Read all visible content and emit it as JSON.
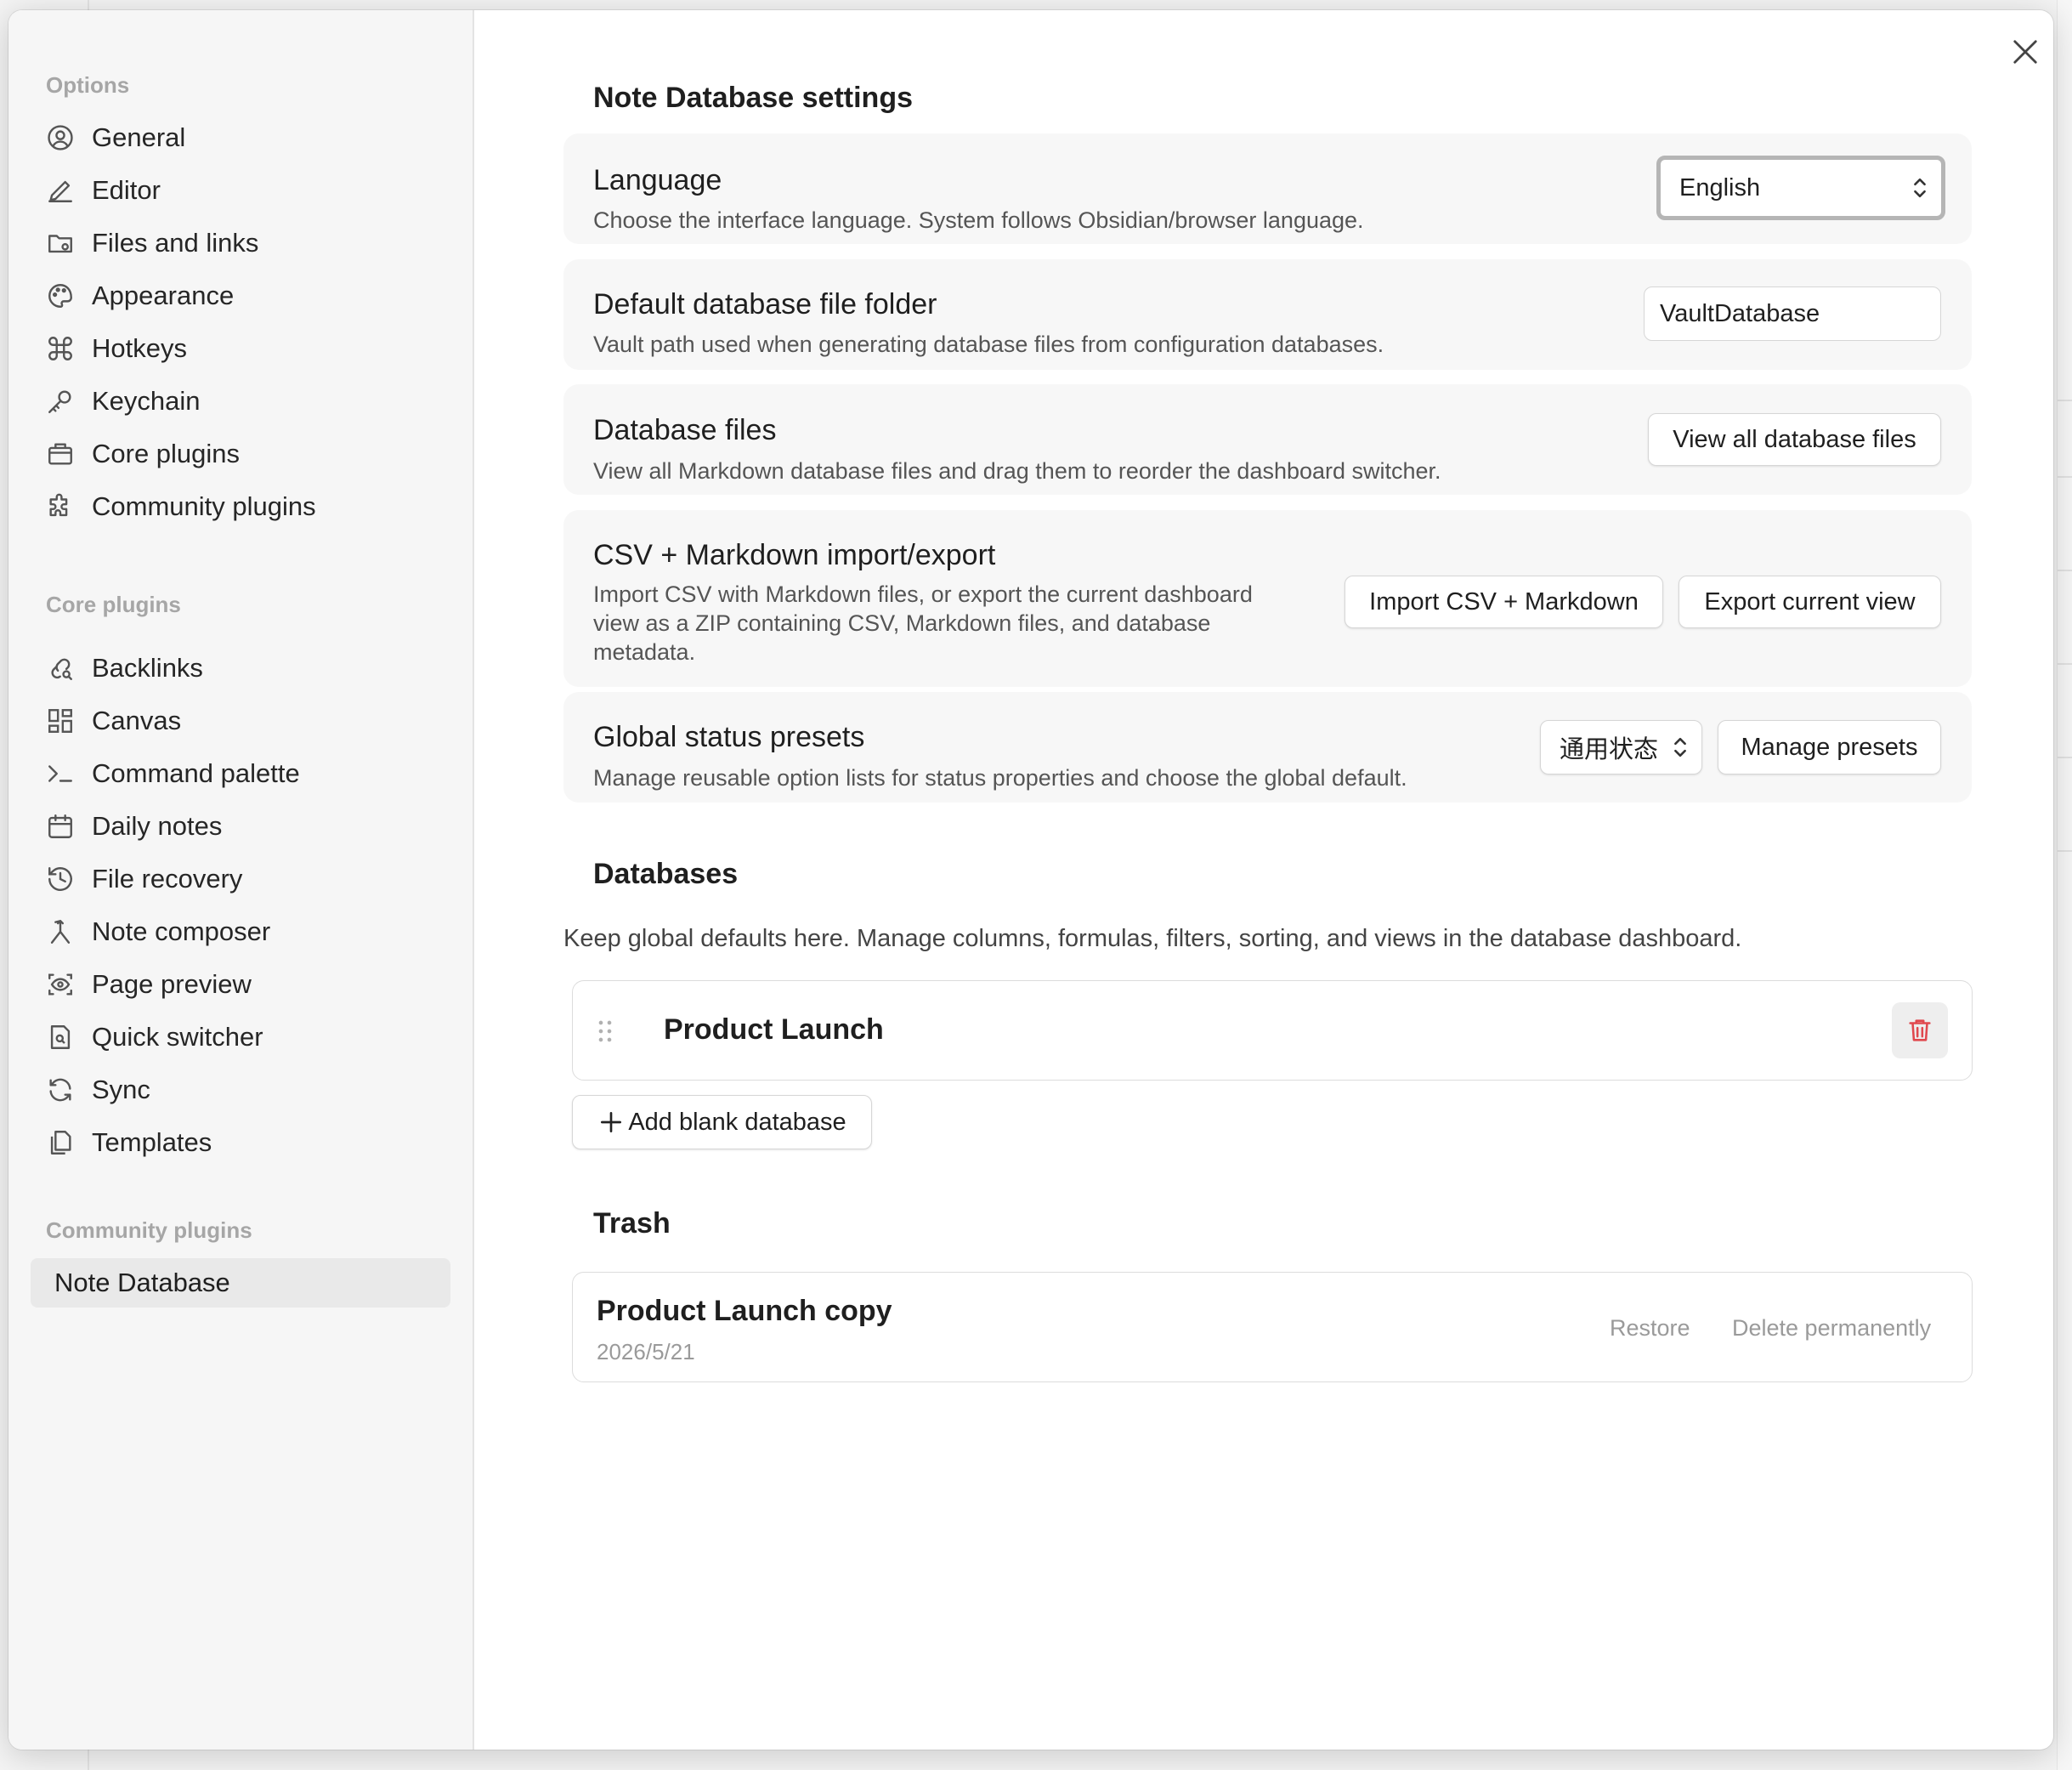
{
  "sidebar": {
    "options_heading": "Options",
    "options_items": [
      {
        "label": "General",
        "icon": "user-circle-icon"
      },
      {
        "label": "Editor",
        "icon": "pencil-icon"
      },
      {
        "label": "Files and links",
        "icon": "folder-cog-icon"
      },
      {
        "label": "Appearance",
        "icon": "palette-icon"
      },
      {
        "label": "Hotkeys",
        "icon": "command-icon"
      },
      {
        "label": "Keychain",
        "icon": "key-icon"
      },
      {
        "label": "Core plugins",
        "icon": "briefcase-icon"
      },
      {
        "label": "Community plugins",
        "icon": "puzzle-icon"
      }
    ],
    "core_heading": "Core plugins",
    "core_items": [
      {
        "label": "Backlinks",
        "icon": "link-search-icon"
      },
      {
        "label": "Canvas",
        "icon": "layout-dashboard-icon"
      },
      {
        "label": "Command palette",
        "icon": "terminal-icon"
      },
      {
        "label": "Daily notes",
        "icon": "calendar-icon"
      },
      {
        "label": "File recovery",
        "icon": "history-icon"
      },
      {
        "label": "Note composer",
        "icon": "merge-icon"
      },
      {
        "label": "Page preview",
        "icon": "eye-scan-icon"
      },
      {
        "label": "Quick switcher",
        "icon": "file-search-icon"
      },
      {
        "label": "Sync",
        "icon": "refresh-icon"
      },
      {
        "label": "Templates",
        "icon": "files-icon"
      }
    ],
    "community_heading": "Community plugins",
    "community_items": [
      {
        "label": "Note Database",
        "active": true
      }
    ]
  },
  "main": {
    "title": "Note Database settings",
    "language": {
      "title": "Language",
      "desc": "Choose the interface language. System follows Obsidian/browser language.",
      "value": "English"
    },
    "folder": {
      "title": "Default database file folder",
      "desc": "Vault path used when generating database files from configuration databases.",
      "value": "VaultDatabase"
    },
    "files": {
      "title": "Database files",
      "desc": "View all Markdown database files and drag them to reorder the dashboard switcher.",
      "button": "View all database files"
    },
    "csv": {
      "title": "CSV + Markdown import/export",
      "desc_lines": [
        "Import CSV with Markdown files, or export the current dashboard",
        "view as a ZIP containing CSV, Markdown files, and database",
        "metadata."
      ],
      "import_button": "Import CSV + Markdown",
      "export_button": "Export current view"
    },
    "status": {
      "title": "Global status presets",
      "desc": "Manage reusable option lists for status properties and choose the global default.",
      "select_value": "通用状态",
      "button": "Manage presets"
    },
    "databases": {
      "heading": "Databases",
      "desc": "Keep global defaults here. Manage columns, formulas, filters, sorting, and views in the database dashboard.",
      "items": [
        {
          "name": "Product Launch"
        }
      ],
      "add_button": "Add blank database"
    },
    "trash": {
      "heading": "Trash",
      "items": [
        {
          "name": "Product Launch copy",
          "date": "2026/5/21"
        }
      ],
      "restore": "Restore",
      "delete": "Delete permanently"
    }
  },
  "colors": {
    "accent_danger": "#e0484e",
    "muted_text": "#9a9a9a",
    "card_bg": "#f7f7f7",
    "sidebar_bg": "#f6f6f6"
  }
}
